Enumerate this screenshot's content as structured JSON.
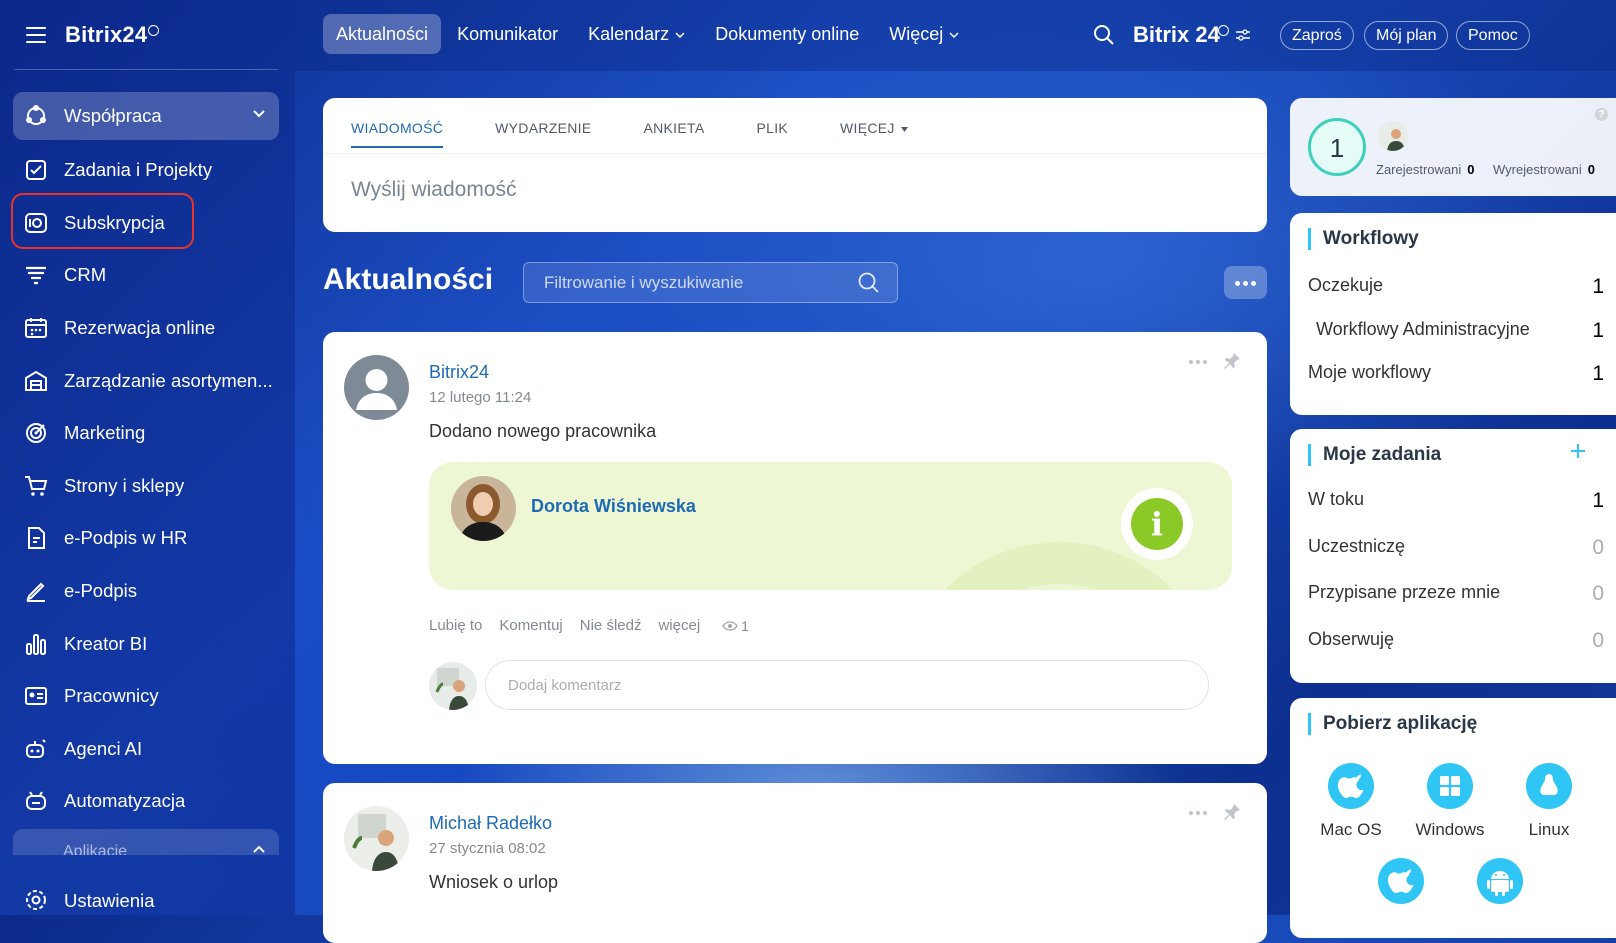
{
  "sidebar": {
    "brand": "Bitrix24",
    "active_group": "Współpraca",
    "items": [
      {
        "label": "Zadania i Projekty",
        "icon": "tasks-icon"
      },
      {
        "label": "Subskrypcja",
        "icon": "subscription-icon"
      },
      {
        "label": "CRM",
        "icon": "crm-icon"
      },
      {
        "label": "Rezerwacja online",
        "icon": "booking-calendar-icon"
      },
      {
        "label": "Zarządzanie asortymen...",
        "icon": "inventory-icon"
      },
      {
        "label": "Marketing",
        "icon": "marketing-target-icon"
      },
      {
        "label": "Strony i sklepy",
        "icon": "cart-icon"
      },
      {
        "label": "e-Podpis w HR",
        "icon": "hr-signature-icon"
      },
      {
        "label": "e-Podpis",
        "icon": "pen-signature-icon"
      },
      {
        "label": "Kreator BI",
        "icon": "bar-chart-icon"
      },
      {
        "label": "Pracownicy",
        "icon": "employees-icon"
      },
      {
        "label": "Agenci AI",
        "icon": "ai-agent-icon"
      },
      {
        "label": "Automatyzacja",
        "icon": "robot-icon"
      }
    ],
    "apps_group": "Aplikacje",
    "settings": "Ustawienia"
  },
  "topbar": {
    "tabs": [
      "Aktualności",
      "Komunikator",
      "Kalendarz",
      "Dokumenty online",
      "Więcej"
    ],
    "brand": "Bitrix 24",
    "buttons": [
      "Zaproś",
      "Mój plan",
      "Pomoc"
    ]
  },
  "composer": {
    "tabs": [
      "WIADOMOŚĆ",
      "WYDARZENIE",
      "ANKIETA",
      "PLIK",
      "WIĘCEJ"
    ],
    "placeholder": "Wyślij wiadomość"
  },
  "feed": {
    "title": "Aktualności",
    "filter_placeholder": "Filtrowanie i wyszukiwanie",
    "posts": [
      {
        "author": "Bitrix24",
        "date": "12 lutego 11:24",
        "text": "Dodano nowego pracownika",
        "employee": "Dorota Wiśniewska",
        "actions": [
          "Lubię to",
          "Komentuj",
          "Nie śledź",
          "więcej"
        ],
        "views": "1",
        "comment_placeholder": "Dodaj komentarz"
      },
      {
        "author": "Michał Radełko",
        "date": "27 stycznia 08:02",
        "text": "Wniosek o urlop"
      }
    ]
  },
  "stats": {
    "count": "1",
    "registered_label": "Zarejestrowani",
    "registered_value": "0",
    "unregistered_label": "Wyrejestrowani",
    "unregistered_value": "0"
  },
  "workflows": {
    "title": "Workflowy",
    "rows": [
      {
        "label": "Oczekuje",
        "value": "1"
      },
      {
        "label": "Workflowy Administracyjne",
        "value": "1"
      },
      {
        "label": "Moje workflowy",
        "value": "1"
      }
    ]
  },
  "tasks": {
    "title": "Moje zadania",
    "rows": [
      {
        "label": "W toku",
        "value": "1"
      },
      {
        "label": "Uczestniczę",
        "value": "0"
      },
      {
        "label": "Przypisane przeze mnie",
        "value": "0"
      },
      {
        "label": "Obserwuję",
        "value": "0"
      }
    ]
  },
  "apps": {
    "title": "Pobierz aplikację",
    "items": [
      "Mac OS",
      "Windows",
      "Linux"
    ]
  },
  "colors": {
    "accent": "#2fc6f6",
    "link": "#1e6bb4",
    "highlight": "#e8322a",
    "info": "#8bc926"
  }
}
